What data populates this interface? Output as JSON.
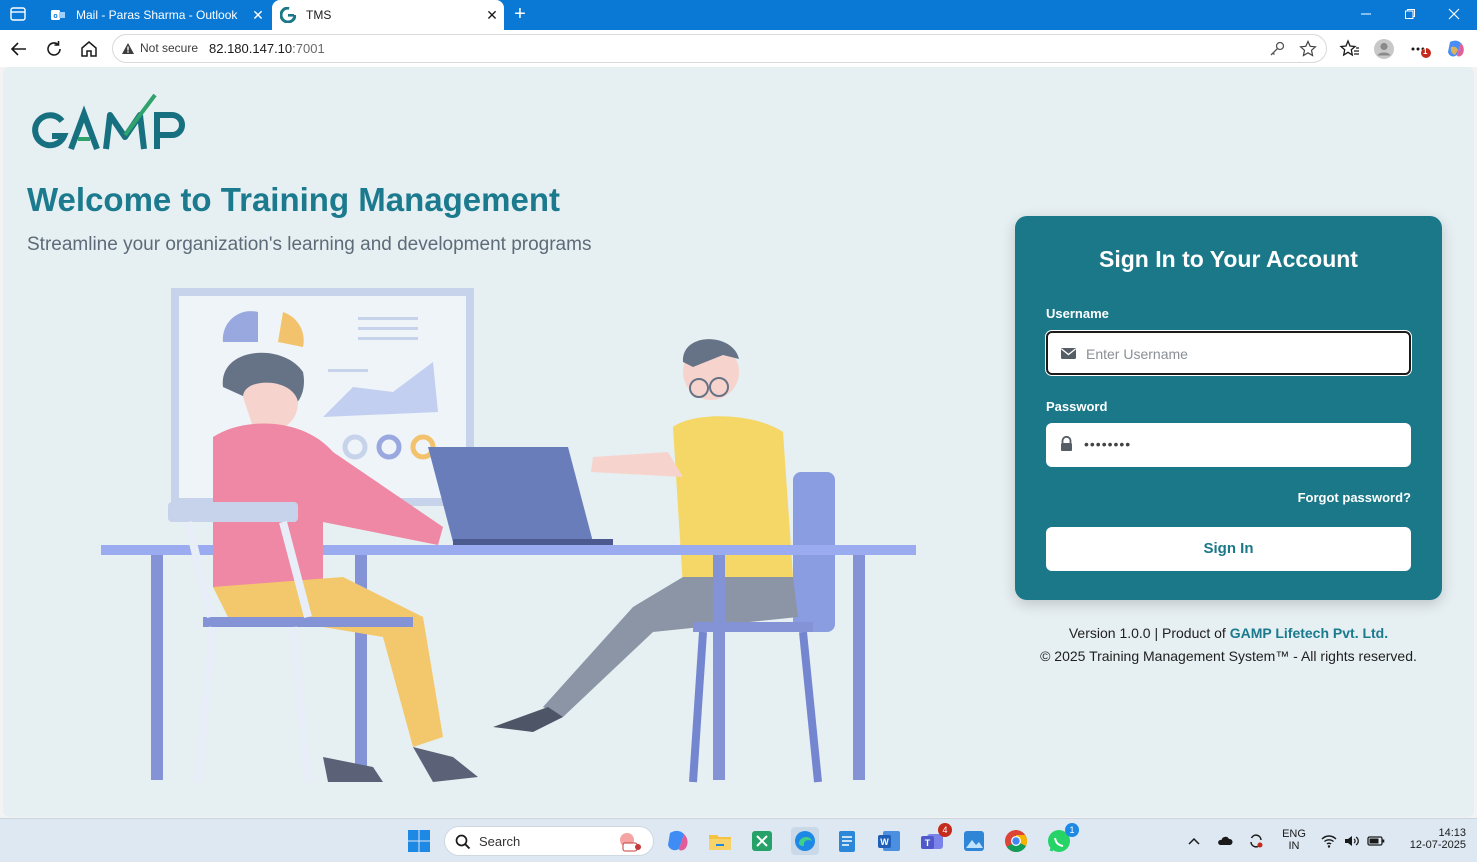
{
  "browser": {
    "tabs": [
      {
        "title": "Mail - Paras Sharma - Outlook",
        "close": "✕"
      },
      {
        "title": "TMS",
        "close": "✕"
      }
    ],
    "new_tab": "+",
    "security_label": "Not secure",
    "url_host": "82.180.147.10",
    "url_port": ":7001",
    "notifications_badge": "1"
  },
  "page": {
    "welcome_title": "Welcome to Training Management",
    "subtitle": "Streamline your organization's learning and development programs",
    "logo_text": "GAMP",
    "login": {
      "title": "Sign In to Your Account",
      "username_label": "Username",
      "username_placeholder": "Enter Username",
      "password_label": "Password",
      "password_value": "••••••••",
      "forgot": "Forgot password?",
      "signin": "Sign In"
    },
    "footer": {
      "version": "Version 1.0.0 | Product of ",
      "company": "GAMP Lifetech Pvt. Ltd.",
      "copyright": "© 2025 Training Management System™ - All rights reserved."
    }
  },
  "taskbar": {
    "search": "Search",
    "teams_badge": "4",
    "whatsapp_badge": "1",
    "lang_top": "ENG",
    "lang_bottom": "IN",
    "time": "14:13",
    "date": "12-07-2025"
  },
  "colors": {
    "brand_teal": "#1a7889",
    "edge_blue": "#0a79d6",
    "page_bg": "#e6eff2"
  }
}
